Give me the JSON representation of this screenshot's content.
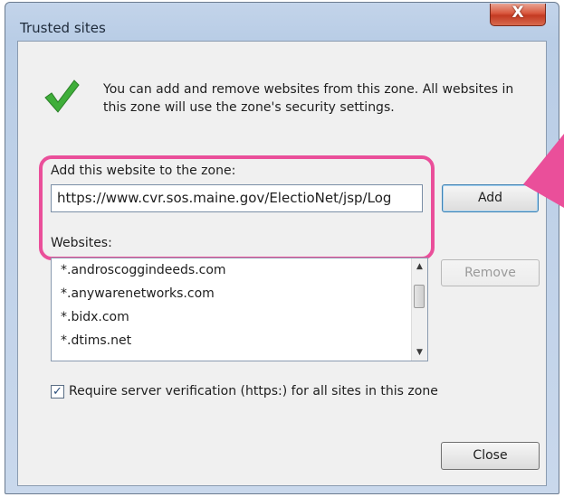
{
  "window": {
    "title": "Trusted sites",
    "close_glyph": "X"
  },
  "intro": {
    "icon": "green-check-icon",
    "text": "You can add and remove websites from this zone. All websites in this zone will use the zone's security settings."
  },
  "add_section": {
    "label": "Add this website to the zone:",
    "url_value": "https://www.cvr.sos.maine.gov/ElectioNet/jsp/Log",
    "add_button": "Add",
    "highlight_color": "#ea4f9a"
  },
  "websites": {
    "label": "Websites:",
    "items": [
      "*.androscoggindeeds.com",
      "*.anywarenetworks.com",
      "*.bidx.com",
      "*.dtims.net"
    ],
    "remove_button": "Remove"
  },
  "verification": {
    "checked": true,
    "label": "Require server verification (https:) for all sites in this zone"
  },
  "footer": {
    "close_button": "Close"
  }
}
